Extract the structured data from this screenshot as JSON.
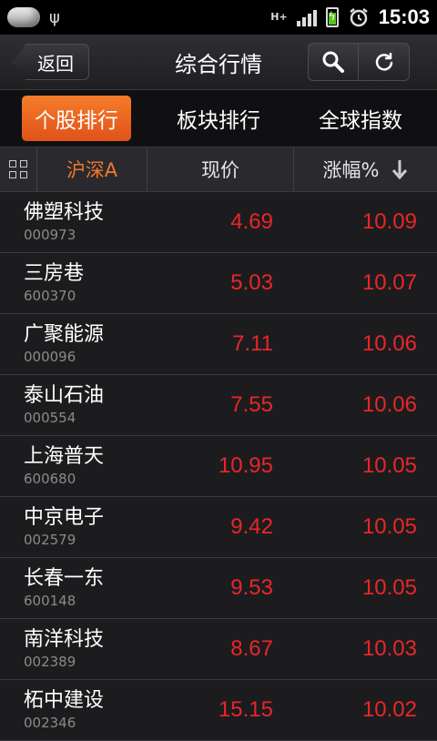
{
  "status": {
    "time": "15:03",
    "network": "H+"
  },
  "header": {
    "back_label": "返回",
    "title": "综合行情"
  },
  "tabs": [
    {
      "label": "个股排行",
      "active": true
    },
    {
      "label": "板块排行",
      "active": false
    },
    {
      "label": "全球指数",
      "active": false
    }
  ],
  "columns": {
    "market": "沪深A",
    "price": "现价",
    "change": "涨幅%"
  },
  "stocks": [
    {
      "name": "佛塑科技",
      "code": "000973",
      "price": "4.69",
      "change": "10.09"
    },
    {
      "name": "三房巷",
      "code": "600370",
      "price": "5.03",
      "change": "10.07"
    },
    {
      "name": "广聚能源",
      "code": "000096",
      "price": "7.11",
      "change": "10.06"
    },
    {
      "name": "泰山石油",
      "code": "000554",
      "price": "7.55",
      "change": "10.06"
    },
    {
      "name": "上海普天",
      "code": "600680",
      "price": "10.95",
      "change": "10.05"
    },
    {
      "name": "中京电子",
      "code": "002579",
      "price": "9.42",
      "change": "10.05"
    },
    {
      "name": "长春一东",
      "code": "600148",
      "price": "9.53",
      "change": "10.05"
    },
    {
      "name": "南洋科技",
      "code": "002389",
      "price": "8.67",
      "change": "10.03"
    },
    {
      "name": "柘中建设",
      "code": "002346",
      "price": "15.15",
      "change": "10.02"
    }
  ],
  "colors": {
    "accent": "#f07a2c",
    "up": "#e8262a"
  }
}
